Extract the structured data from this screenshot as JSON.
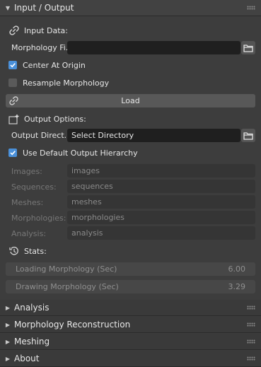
{
  "header": {
    "title": "Input / Output"
  },
  "input": {
    "section_label": "Input Data:",
    "morphology_label": "Morphology Fi..",
    "morphology_value": "",
    "center_label": "Center At Origin",
    "center_checked": true,
    "resample_label": "Resample Morphology",
    "resample_checked": false,
    "load_label": "Load"
  },
  "output": {
    "section_label": "Output Options:",
    "dir_label": "Output Direct..",
    "dir_value": "Select Directory",
    "hierarchy_label": "Use Default Output Hierarchy",
    "hierarchy_checked": true,
    "rows": [
      {
        "label": "Images:",
        "value": "images"
      },
      {
        "label": "Sequences:",
        "value": "sequences"
      },
      {
        "label": "Meshes:",
        "value": "meshes"
      },
      {
        "label": "Morphologies:",
        "value": "morphologies"
      },
      {
        "label": "Analysis:",
        "value": "analysis"
      }
    ]
  },
  "stats": {
    "section_label": "Stats:",
    "rows": [
      {
        "label": "Loading Morphology (Sec)",
        "value": "6.00"
      },
      {
        "label": "Drawing Morphology (Sec)",
        "value": "3.29"
      }
    ]
  },
  "panels": [
    {
      "title": "Analysis"
    },
    {
      "title": "Morphology Reconstruction"
    },
    {
      "title": "Meshing"
    },
    {
      "title": "About"
    }
  ],
  "colors": {
    "accent": "#4a90d9",
    "background": "#3d3d3d",
    "field": "#1f1f1f"
  },
  "icons": {
    "link": "link-icon",
    "folder": "folder-icon",
    "output": "output-add-icon",
    "stats": "clock-icon"
  }
}
